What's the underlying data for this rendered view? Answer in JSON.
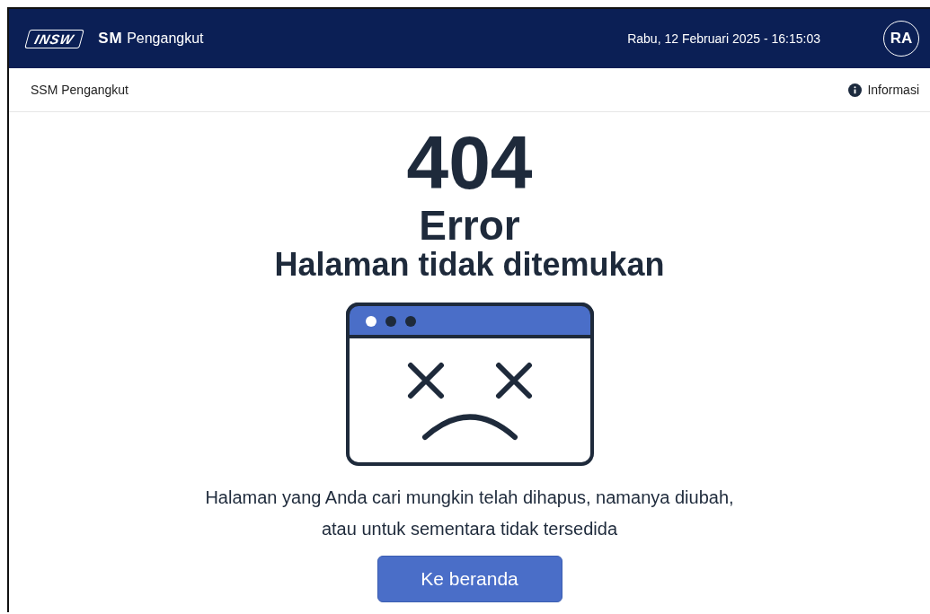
{
  "header": {
    "logo": "INSW",
    "app_title_prefix": "SM",
    "app_title": "Pengangkut",
    "datetime": "Rabu, 12 Februari 2025 - 16:15:03",
    "avatar": "RA"
  },
  "subheader": {
    "breadcrumb": "SSM Pengangkut",
    "info_link": "Informasi"
  },
  "error": {
    "code": "404",
    "title": "Error",
    "subtitle": "Halaman tidak ditemukan",
    "message_lines": [
      "Halaman yang Anda cari mungkin telah dihapus, namanya diubah,",
      "atau untuk sementara tidak tersedida"
    ],
    "button": "Ke beranda"
  }
}
